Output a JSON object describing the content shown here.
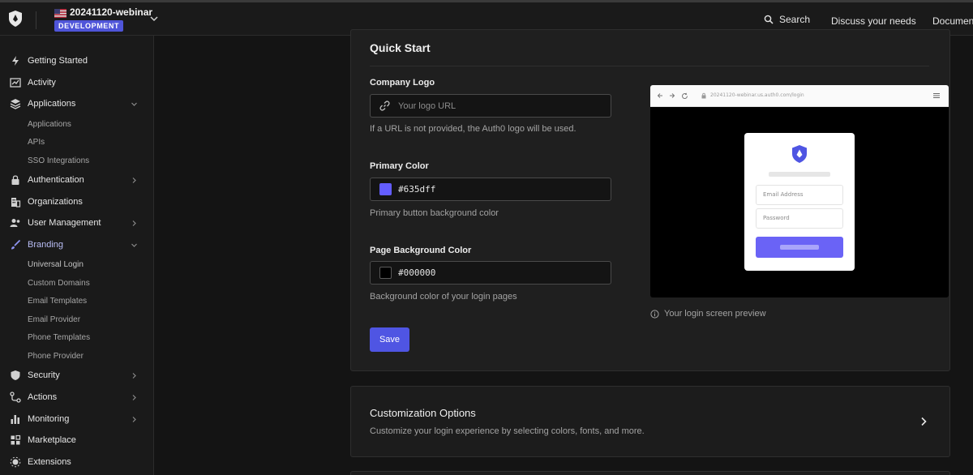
{
  "topbar": {
    "tenant_name": "20241120-webinar",
    "environment": "DEVELOPMENT",
    "search_label": "Search",
    "discuss_label": "Discuss your needs",
    "docs_label": "Document"
  },
  "sidebar": {
    "items": [
      {
        "label": "Getting Started",
        "icon": "bolt-icon"
      },
      {
        "label": "Activity",
        "icon": "activity-chart-icon"
      },
      {
        "label": "Applications",
        "icon": "layers-icon",
        "expanded": true,
        "children": [
          "Applications",
          "APIs",
          "SSO Integrations"
        ]
      },
      {
        "label": "Authentication",
        "icon": "lock-icon"
      },
      {
        "label": "Organizations",
        "icon": "building-icon"
      },
      {
        "label": "User Management",
        "icon": "users-icon"
      },
      {
        "label": "Branding",
        "icon": "brush-icon",
        "expanded": true,
        "active": true,
        "children": [
          "Universal Login",
          "Custom Domains",
          "Email Templates",
          "Email Provider",
          "Phone Templates",
          "Phone Provider"
        ]
      },
      {
        "label": "Security",
        "icon": "shield-icon"
      },
      {
        "label": "Actions",
        "icon": "actions-flow-icon"
      },
      {
        "label": "Monitoring",
        "icon": "bar-chart-icon"
      },
      {
        "label": "Marketplace",
        "icon": "marketplace-icon"
      },
      {
        "label": "Extensions",
        "icon": "extensions-icon"
      }
    ]
  },
  "quick_start": {
    "title": "Quick Start",
    "company_logo": {
      "label": "Company Logo",
      "placeholder": "Your logo URL",
      "help": "If a URL is not provided, the Auth0 logo will be used."
    },
    "primary_color": {
      "label": "Primary Color",
      "value": "#635dff",
      "swatch": "#635dff",
      "help": "Primary button background color"
    },
    "page_background": {
      "label": "Page Background Color",
      "value": "#000000",
      "swatch": "#000000",
      "help": "Background color of your login pages"
    },
    "save_label": "Save"
  },
  "preview": {
    "url": "20241120-webinar.us.auth0.com/login",
    "email_placeholder": "Email Address",
    "password_placeholder": "Password",
    "caption": "Your login screen preview"
  },
  "customization": {
    "title": "Customization Options",
    "description": "Customize your login experience by selecting colors, fonts, and more."
  },
  "colors": {
    "accent": "#4f55e3",
    "background": "#141414",
    "panel": "#1f1f1f"
  }
}
